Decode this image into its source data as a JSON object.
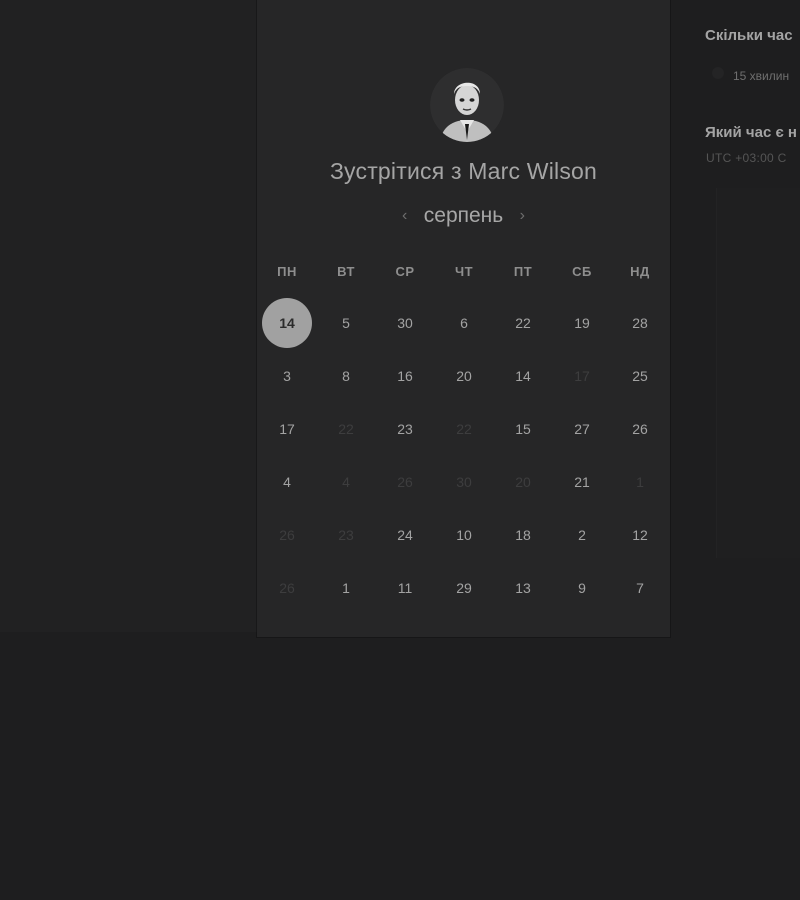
{
  "scheduler": {
    "title": "Зустрітися з Marc Wilson",
    "month": "серпень",
    "prev_arrow": "‹",
    "next_arrow": "›",
    "weekdays": [
      "ПН",
      "ВТ",
      "СР",
      "ЧТ",
      "ПТ",
      "СБ",
      "НД"
    ],
    "weeks": [
      [
        {
          "d": "14",
          "s": "selected"
        },
        {
          "d": "5",
          "s": "enabled"
        },
        {
          "d": "30",
          "s": "enabled"
        },
        {
          "d": "6",
          "s": "enabled"
        },
        {
          "d": "22",
          "s": "enabled"
        },
        {
          "d": "19",
          "s": "enabled"
        },
        {
          "d": "28",
          "s": "enabled"
        }
      ],
      [
        {
          "d": "3",
          "s": "enabled"
        },
        {
          "d": "8",
          "s": "enabled"
        },
        {
          "d": "16",
          "s": "enabled"
        },
        {
          "d": "20",
          "s": "enabled"
        },
        {
          "d": "14",
          "s": "enabled"
        },
        {
          "d": "17",
          "s": "disabled"
        },
        {
          "d": "25",
          "s": "enabled"
        }
      ],
      [
        {
          "d": "17",
          "s": "enabled"
        },
        {
          "d": "22",
          "s": "disabled"
        },
        {
          "d": "23",
          "s": "enabled"
        },
        {
          "d": "22",
          "s": "disabled"
        },
        {
          "d": "15",
          "s": "enabled"
        },
        {
          "d": "27",
          "s": "enabled"
        },
        {
          "d": "26",
          "s": "enabled"
        }
      ],
      [
        {
          "d": "4",
          "s": "enabled"
        },
        {
          "d": "4",
          "s": "disabled"
        },
        {
          "d": "26",
          "s": "disabled"
        },
        {
          "d": "30",
          "s": "disabled"
        },
        {
          "d": "20",
          "s": "disabled"
        },
        {
          "d": "21",
          "s": "enabled"
        },
        {
          "d": "1",
          "s": "disabled"
        }
      ],
      [
        {
          "d": "26",
          "s": "disabled"
        },
        {
          "d": "23",
          "s": "disabled"
        },
        {
          "d": "24",
          "s": "enabled"
        },
        {
          "d": "10",
          "s": "enabled"
        },
        {
          "d": "18",
          "s": "enabled"
        },
        {
          "d": "2",
          "s": "enabled"
        },
        {
          "d": "12",
          "s": "enabled"
        }
      ],
      [
        {
          "d": "26",
          "s": "disabled"
        },
        {
          "d": "1",
          "s": "enabled"
        },
        {
          "d": "11",
          "s": "enabled"
        },
        {
          "d": "29",
          "s": "enabled"
        },
        {
          "d": "13",
          "s": "enabled"
        },
        {
          "d": "9",
          "s": "enabled"
        },
        {
          "d": "7",
          "s": "enabled"
        }
      ]
    ]
  },
  "details": {
    "duration_question": "Скільки час",
    "duration_option": "15 хвилин",
    "time_question": "Який час є н",
    "timezone": "UTC +03:00 С"
  },
  "colors": {
    "background": "#1e1e1f",
    "card": "#262627",
    "selected_day": "#a1a1a1",
    "text": "#a5a5a5",
    "disabled_text": "#3d3d3e"
  }
}
